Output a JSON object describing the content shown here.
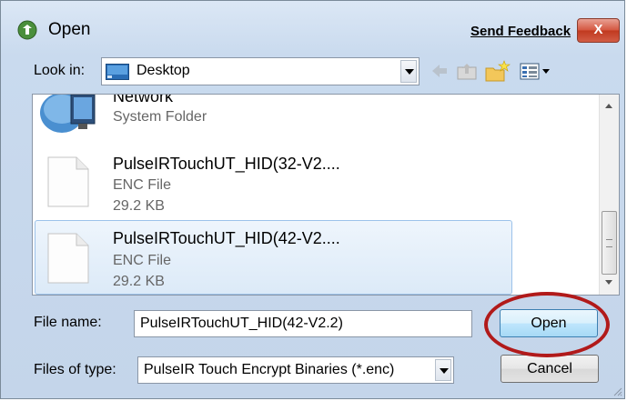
{
  "window": {
    "title": "Open",
    "feedback_link": "Send Feedback",
    "close_symbol": "X"
  },
  "lookin": {
    "label": "Look in:",
    "value": "Desktop"
  },
  "toolbar": {
    "icons": [
      "back-arrow-icon",
      "up-folder-icon",
      "new-folder-icon",
      "view-menu-icon"
    ]
  },
  "files": [
    {
      "name": "Network",
      "type": "System Folder",
      "size": "",
      "icon": "network-icon"
    },
    {
      "name": "PulseIRTouchUT_HID(32-V2....",
      "type": "ENC File",
      "size": "29.2 KB",
      "icon": "document-icon"
    },
    {
      "name": "PulseIRTouchUT_HID(42-V2....",
      "type": "ENC File",
      "size": "29.2 KB",
      "icon": "document-icon",
      "selected": true
    }
  ],
  "filename": {
    "label": "File name:",
    "value": "PulseIRTouchUT_HID(42-V2.2)"
  },
  "filetype": {
    "label": "Files of type:",
    "value": "PulseIR Touch Encrypt Binaries (*.enc)"
  },
  "buttons": {
    "open": "Open",
    "cancel": "Cancel"
  },
  "colors": {
    "highlight_ring": "#b11a1a",
    "selection": "#dceaf8"
  }
}
